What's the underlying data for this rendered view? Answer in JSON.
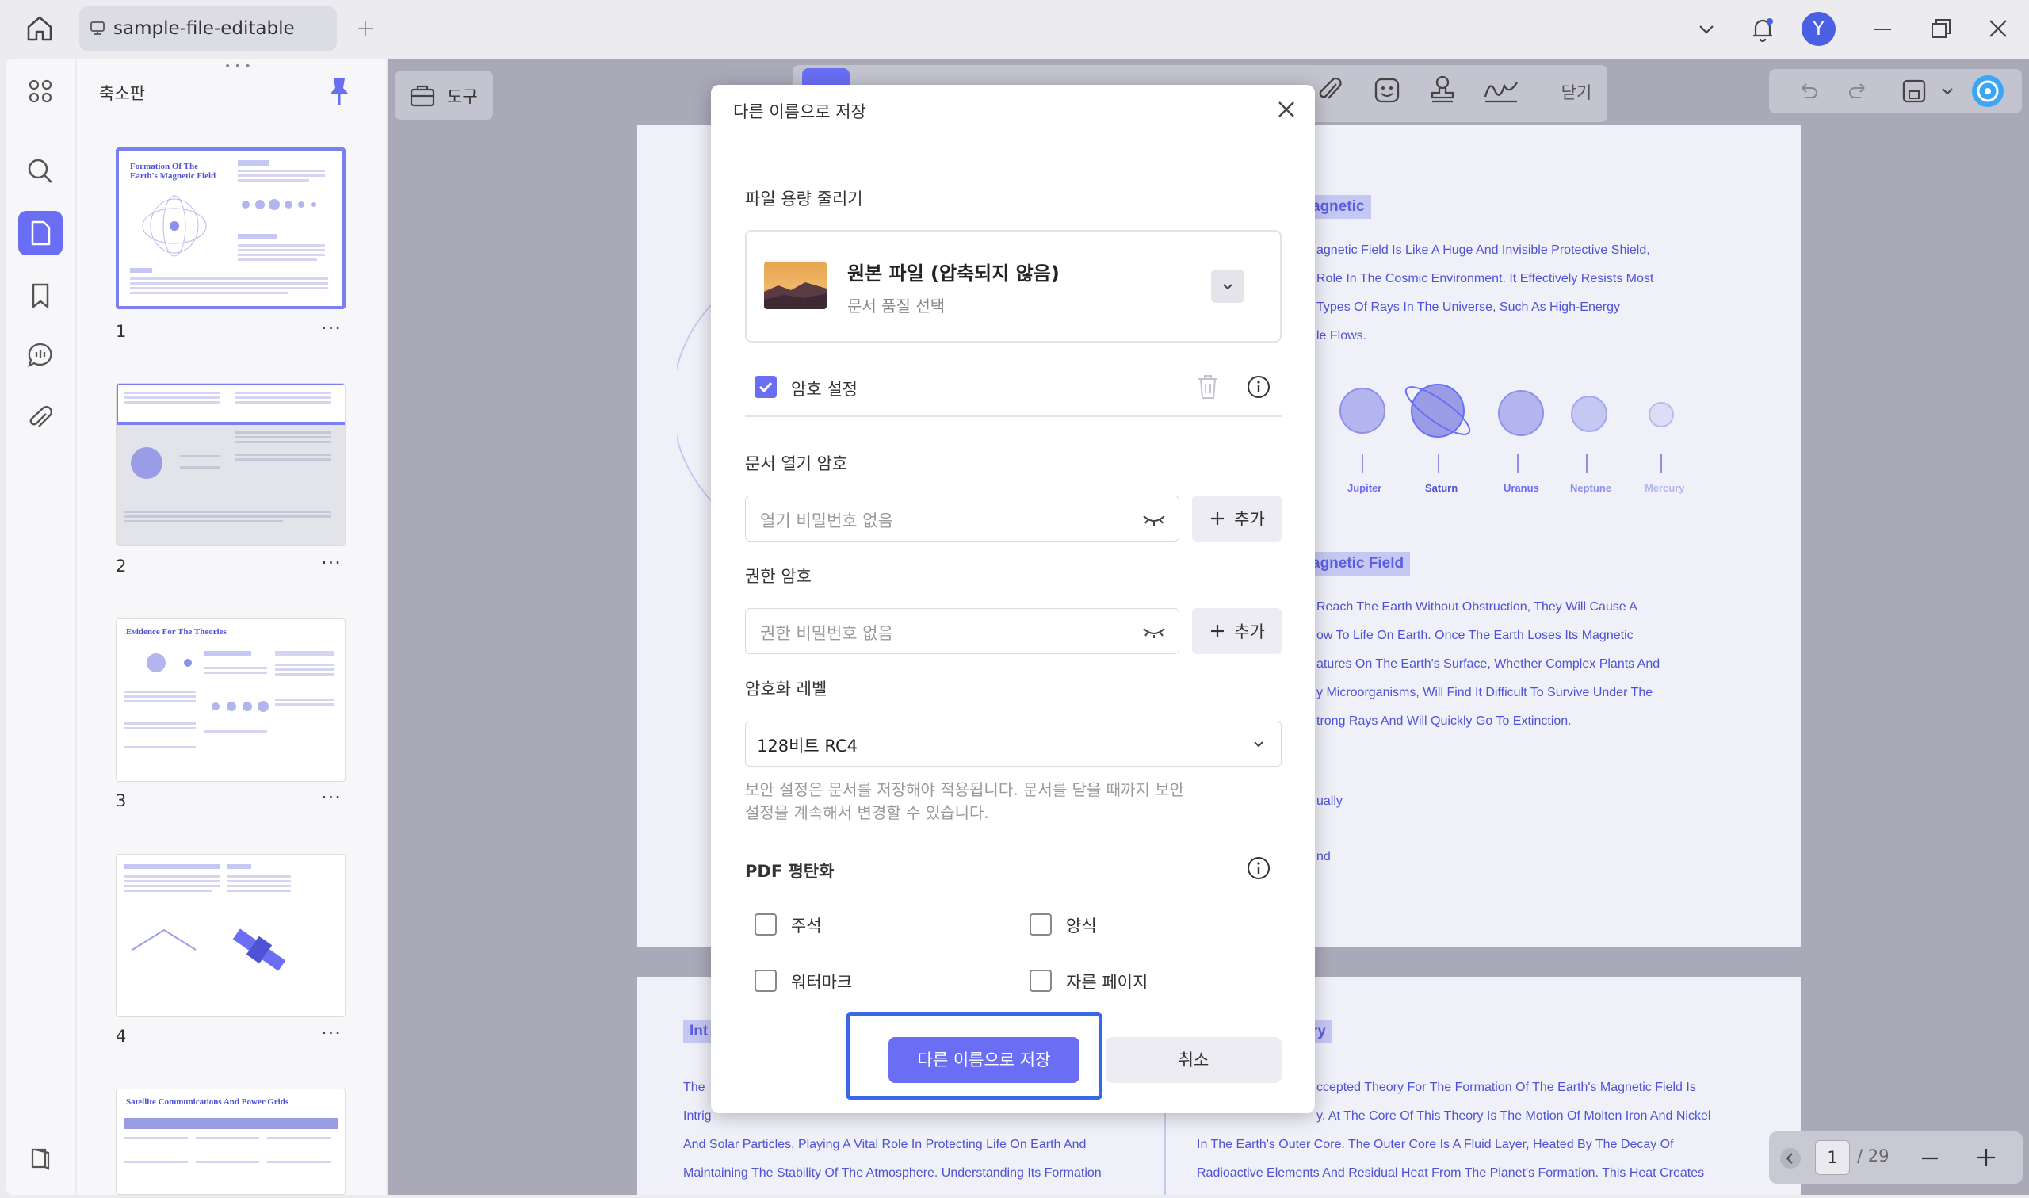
{
  "titlebar": {
    "tab_label": "sample-file-editable",
    "avatar_initial": "Y"
  },
  "thumbnails": {
    "title": "축소판",
    "pages": [
      {
        "number": "1",
        "heading": "Formation Of The Earth's Magnetic Field"
      },
      {
        "number": "2"
      },
      {
        "number": "3",
        "heading": "Evidence For The Theories"
      },
      {
        "number": "4"
      },
      {
        "heading": "Satellite Communications And Power Grids"
      }
    ],
    "more": "···"
  },
  "toolbar": {
    "tools_label": "도구",
    "close_label": "닫기"
  },
  "document": {
    "tag_magnetic": "agnetic",
    "para1": [
      "agnetic Field Is Like A Huge And Invisible Protective Shield,",
      "Role In The Cosmic Environment. It Effectively Resists Most",
      "Types Of Rays In The Universe, Such As High-Energy",
      "le Flows."
    ],
    "planets": [
      "Jupiter",
      "Saturn",
      "Uranus",
      "Neptune",
      "Mercury"
    ],
    "tag_field": "agnetic Field",
    "para2": [
      "Reach The Earth Without Obstruction, They Will Cause A",
      "ow To Life On Earth. Once The Earth Loses Its Magnetic",
      "atures On The Earth's Surface, Whether Complex Plants And",
      "y Microorganisms, Will Find It Difficult To Survive Under The",
      "trong Rays And Will Quickly Go To Extinction."
    ],
    "frag1": "ually",
    "frag2": "nd",
    "tag_int": "Int",
    "tag_ry": "ry",
    "bottom_left": [
      "The",
      "Intrig",
      "And Solar Particles, Playing A Vital Role In Protecting Life On Earth And",
      "Maintaining The Stability Of The Atmosphere. Understanding Its Formation"
    ],
    "bottom_right": [
      "ccepted Theory For The Formation Of The Earth's Magnetic Field Is",
      "y. At The Core Of This Theory Is The Motion Of Molten Iron And Nickel",
      "In The Earth's Outer Core. The Outer Core Is A Fluid Layer, Heated By The Decay Of",
      "Radioactive Elements And Residual Heat From The Planet's Formation. This Heat Creates"
    ]
  },
  "pager": {
    "current": "1",
    "total": "/ 29"
  },
  "dialog": {
    "title": "다른 이름으로 저장",
    "reduce_title": "파일 용량 줄리기",
    "quality_main": "원본 파일 (압축되지 않음)",
    "quality_sub": "문서 품질 선택",
    "password_setting": "암호 설정",
    "password_checked": true,
    "open_password_title": "문서 열기 암호",
    "open_password_placeholder": "열기 비밀번호 없음",
    "add_label": "추가",
    "permission_title": "권한 암호",
    "permission_placeholder": "권한 비밀번호 없음",
    "encryption_title": "암호화 레벨",
    "encryption_value": "128비트 RC4",
    "notice_line1": "보안 설정은 문서를 저장해야 적용됩니다. 문서를 닫을 때까지 보안",
    "notice_line2": "설정을 계속해서 변경할 수 있습니다.",
    "flatten_title": "PDF 평탄화",
    "flatten_options": [
      {
        "label": "주석",
        "checked": false
      },
      {
        "label": "양식",
        "checked": false
      },
      {
        "label": "워터마크",
        "checked": false
      },
      {
        "label": "자른 페이지",
        "checked": false
      }
    ],
    "save_label": "다른 이름으로 저장",
    "cancel_label": "취소"
  },
  "colors": {
    "accent": "#6a6ef5",
    "focus_frame": "#3768e6",
    "avatar": "#4b5fe3"
  }
}
